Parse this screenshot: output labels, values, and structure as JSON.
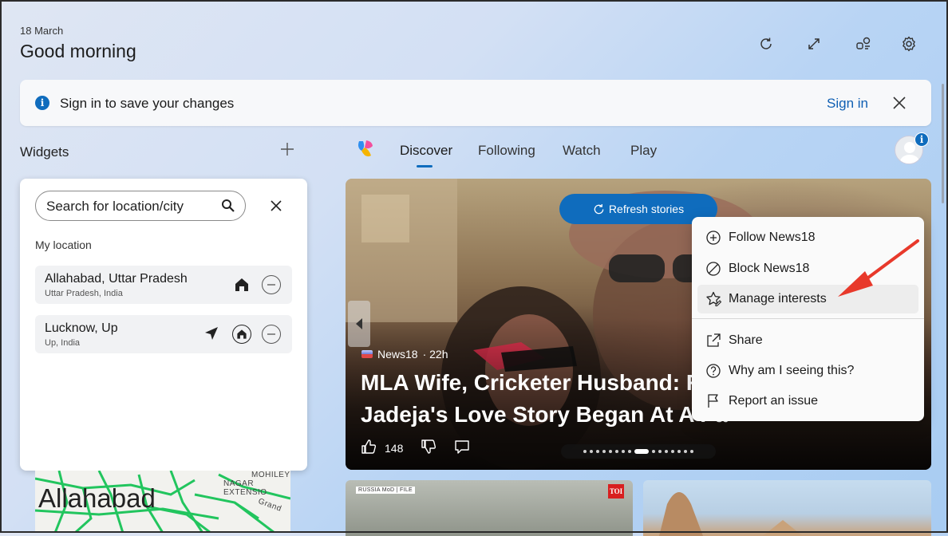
{
  "header": {
    "date": "18 March",
    "greeting": "Good morning",
    "icons": [
      "refresh-icon",
      "expand-icon",
      "widgets-icon",
      "settings-icon"
    ]
  },
  "banner": {
    "text": "Sign in to save your changes",
    "signin_label": "Sign in"
  },
  "widgets": {
    "title": "Widgets",
    "search_placeholder": "Search for location/city",
    "my_location_label": "My location",
    "locations": [
      {
        "name": "Allahabad, Uttar Pradesh",
        "sub": "Uttar Pradesh, India"
      },
      {
        "name": "Lucknow, Up",
        "sub": "Up, India"
      }
    ],
    "map": {
      "city": "Allahabad",
      "label1": "MOHILEY",
      "label2": "NAGAR EXTENSIO",
      "label3": "Grand"
    }
  },
  "feed": {
    "tabs": [
      {
        "label": "Discover"
      },
      {
        "label": "Following"
      },
      {
        "label": "Watch"
      },
      {
        "label": "Play"
      }
    ],
    "active_tab": "Discover",
    "refresh_label": "Refresh stories",
    "hero": {
      "source": "News18",
      "age": "· 22h",
      "headline": "MLA Wife, Cricketer Husband: R... Jadeja's Love Story Began At A Party",
      "headline_line1": "MLA Wife, Cricketer Husband: R",
      "headline_line2": "Jadeja's Love Story Began At A Pa",
      "likes": "148",
      "dots_count": 16,
      "active_dot": 8
    },
    "card2": {
      "tag": "RUSSIA MoD | FILE",
      "badge": "TOI"
    }
  },
  "context_menu": {
    "items": [
      {
        "label": "Follow News18",
        "icon": "plus-circle-icon"
      },
      {
        "label": "Block News18",
        "icon": "block-icon"
      },
      {
        "label": "Manage interests",
        "icon": "star-edit-icon"
      },
      {
        "label": "Share",
        "icon": "share-icon"
      },
      {
        "label": "Why am I seeing this?",
        "icon": "help-icon"
      },
      {
        "label": "Report an issue",
        "icon": "flag-icon"
      }
    ],
    "highlighted": "Manage interests"
  },
  "colors": {
    "accent": "#0f6cbd",
    "annotation_arrow": "#e8392b"
  }
}
